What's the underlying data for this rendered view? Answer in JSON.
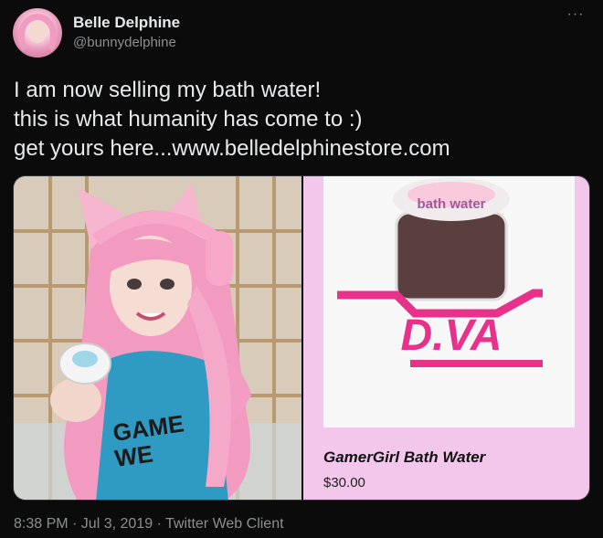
{
  "author": {
    "display_name": "Belle Delphine",
    "handle": "@bunnydelphine"
  },
  "tweet": {
    "lines": [
      "I am now selling my bath water!",
      "this is what humanity has come to :)",
      "get yours here...www.belledelphinestore.com"
    ],
    "timestamp": "8:38 PM · Jul 3, 2019 · Twitter Web Client"
  },
  "media": {
    "photo_description_icon": "person-holding-jar",
    "product": {
      "logo_text": "D.VA",
      "jar_label": "bath water",
      "title": "GamerGirl Bath Water",
      "price": "$30.00"
    },
    "shirt_text": "GAME WE"
  },
  "colors": {
    "background": "#0b0b0c",
    "text": "#e7e9ea",
    "secondary_text": "#8b8f94",
    "product_card_bg": "#f3c6ec",
    "dva_pink": "#e8318a",
    "hair_pink": "#f29ac0"
  }
}
